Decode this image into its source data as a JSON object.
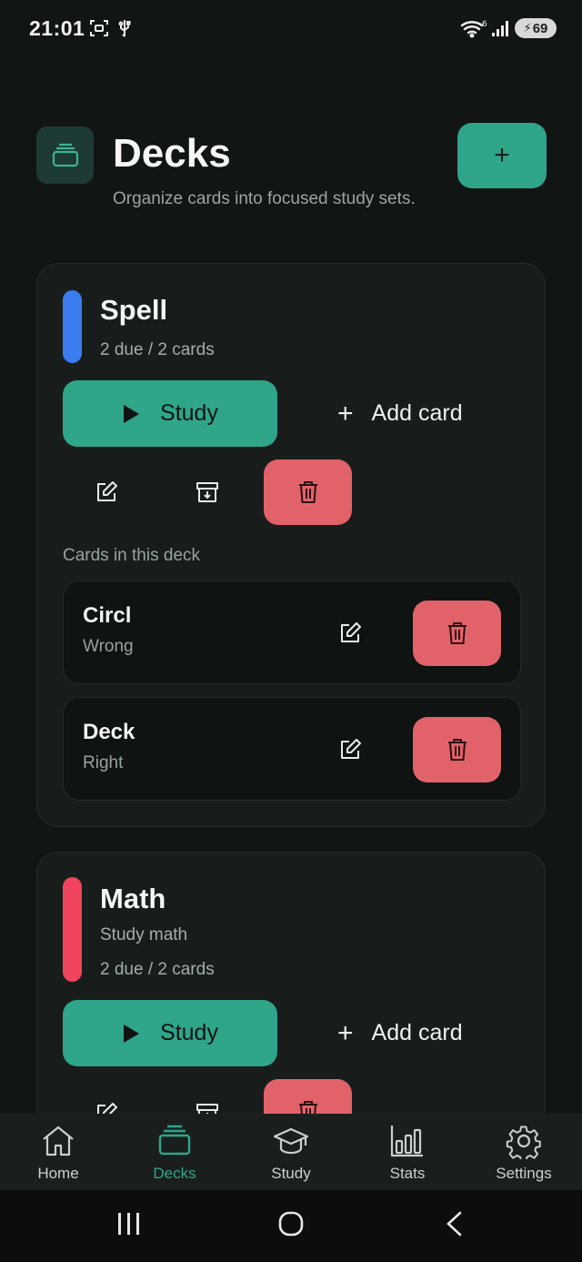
{
  "status_bar": {
    "time": "21:01",
    "battery": "69"
  },
  "header": {
    "title": "Decks",
    "subtitle": "Organize cards into focused study sets.",
    "add_button_symbol": "+"
  },
  "decks": [
    {
      "name": "Spell",
      "description": "",
      "due_text": "2 due / 2 cards",
      "accent_color": "#3b7cf0",
      "study_label": "Study",
      "add_card_label": "Add card",
      "cards_section_label": "Cards in this deck",
      "cards": [
        {
          "front": "Circl",
          "back": "Wrong"
        },
        {
          "front": "Deck",
          "back": "Right"
        }
      ]
    },
    {
      "name": "Math",
      "description": "Study math",
      "due_text": "2 due / 2 cards",
      "accent_color": "#f0445f",
      "study_label": "Study",
      "add_card_label": "Add card"
    }
  ],
  "bottom_nav": {
    "items": [
      {
        "label": "Home",
        "icon": "home-icon"
      },
      {
        "label": "Decks",
        "icon": "decks-icon",
        "active": true
      },
      {
        "label": "Study",
        "icon": "study-cap-icon"
      },
      {
        "label": "Stats",
        "icon": "stats-icon"
      },
      {
        "label": "Settings",
        "icon": "gear-icon"
      }
    ]
  },
  "colors": {
    "background": "#111514",
    "card": "#181d1c",
    "primary": "#2fa58a",
    "danger": "#e2626a",
    "text_muted": "#9aa6a2"
  }
}
